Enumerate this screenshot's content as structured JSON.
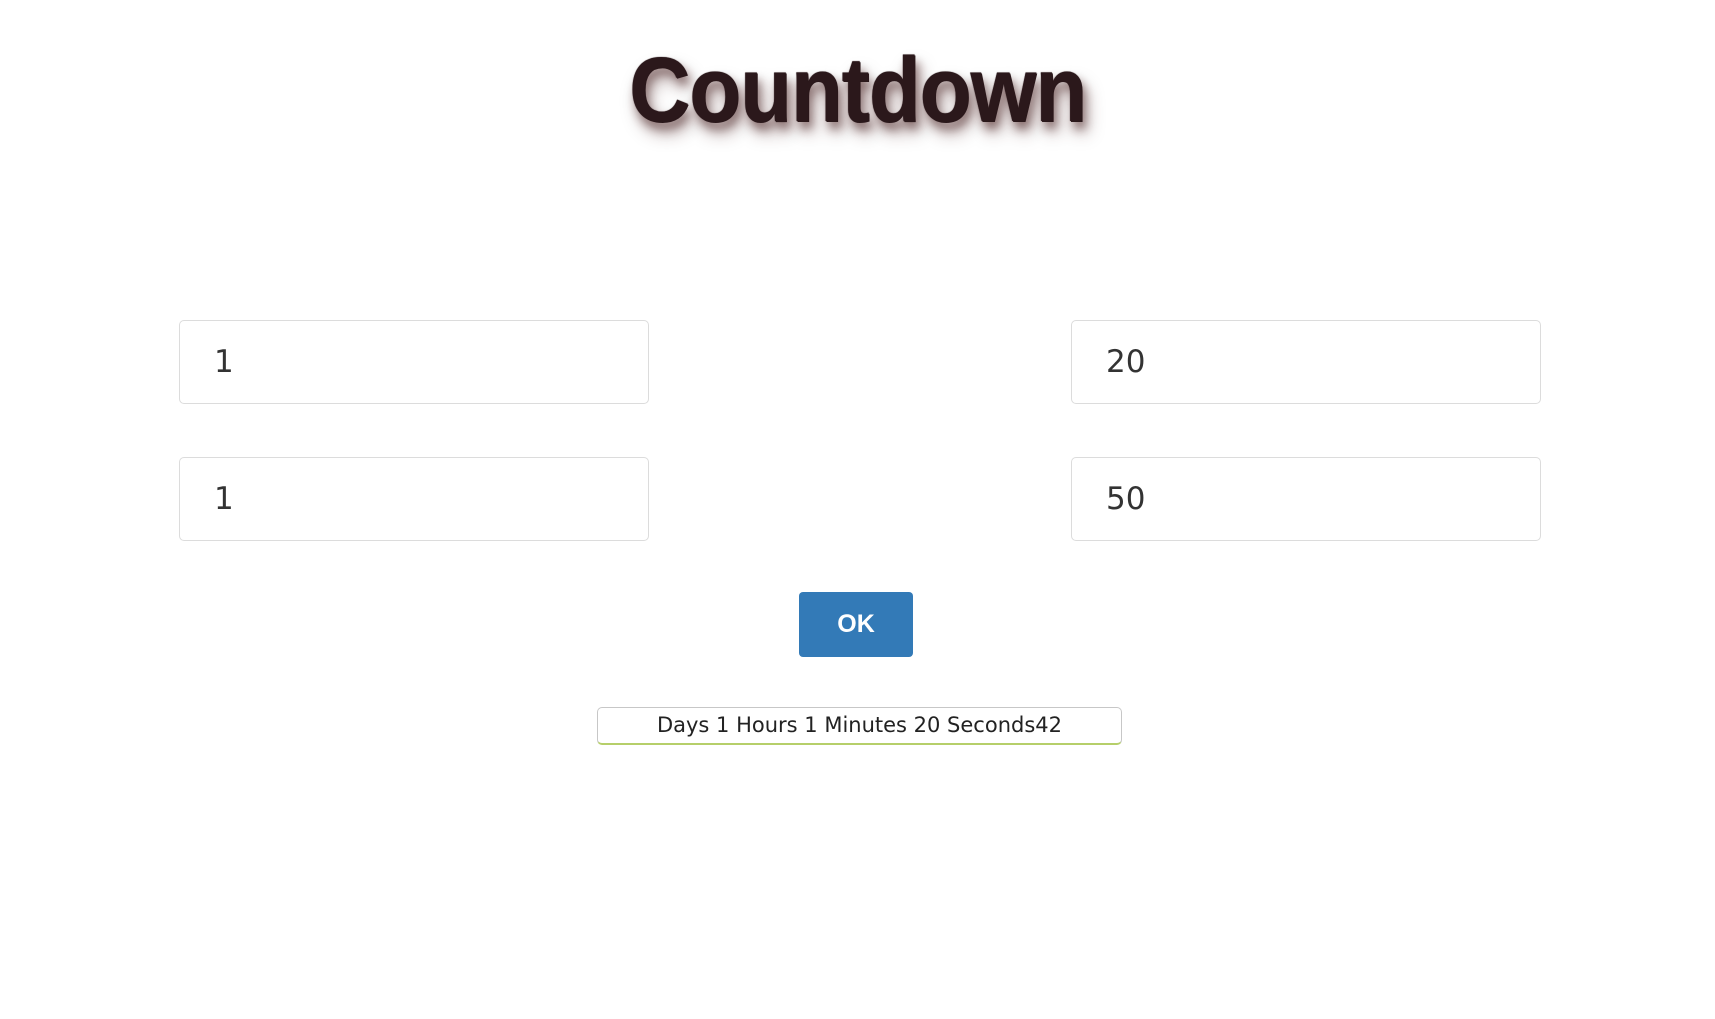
{
  "header": {
    "title": "Countdown"
  },
  "form": {
    "days_value": "1",
    "hours_value": "1",
    "minutes_value": "20",
    "seconds_value": "50"
  },
  "actions": {
    "ok_label": "OK"
  },
  "result": {
    "text": "Days 1 Hours 1 Minutes 20 Seconds42"
  },
  "colors": {
    "title": "#2b181b",
    "button": "#337ab7",
    "result_underline": "#b6cf6a"
  }
}
